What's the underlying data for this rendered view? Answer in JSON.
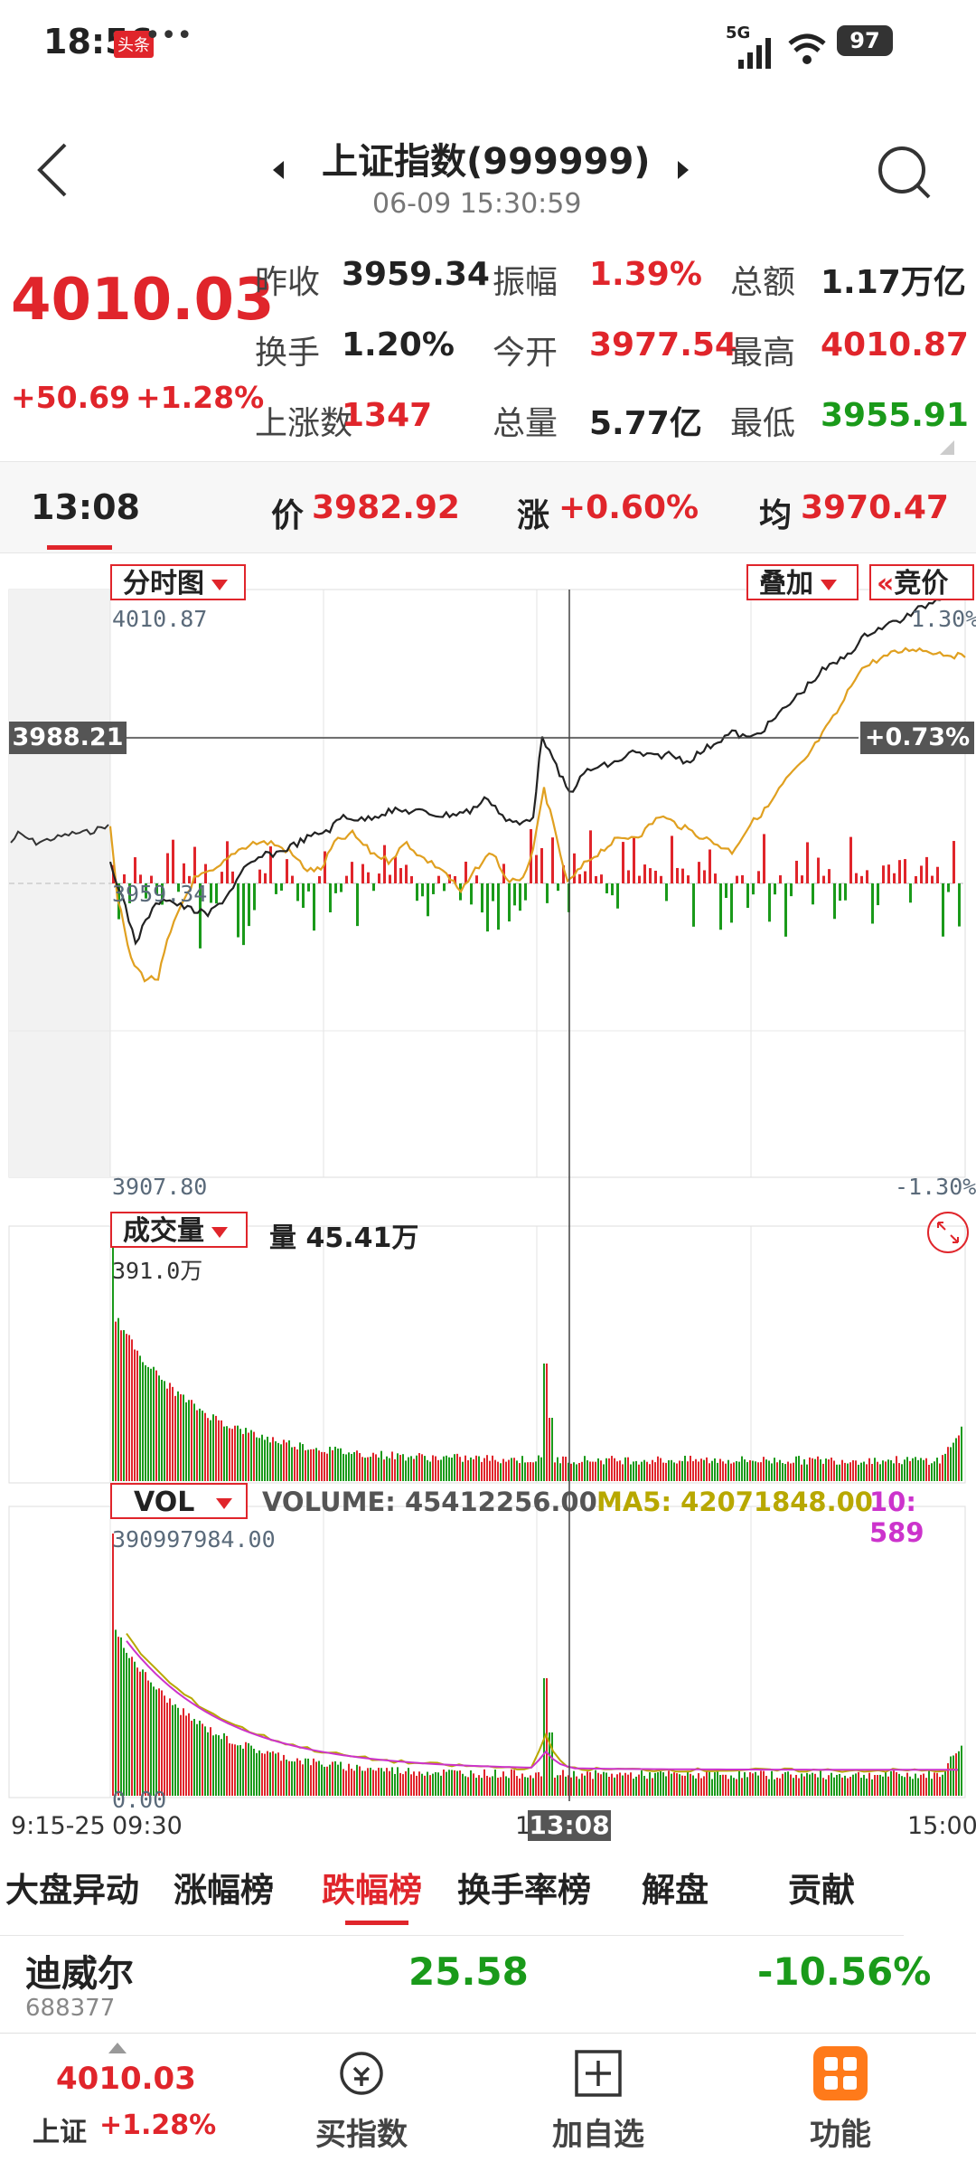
{
  "status": {
    "time": "18:56",
    "app_badge": "头条",
    "more": "•••",
    "network": "5G",
    "battery": "97"
  },
  "header": {
    "title": "上证指数(999999)",
    "datetime": "06-09 15:30:59"
  },
  "quote": {
    "price": "4010.03",
    "change": "+50.69",
    "change_pct": "+1.28%",
    "rows": [
      [
        {
          "label": "昨收",
          "value": "3959.34",
          "color": "dark"
        },
        {
          "label": "振幅",
          "value": "1.39%",
          "color": "red"
        },
        {
          "label": "总额",
          "value": "1.17万亿",
          "color": "dark"
        }
      ],
      [
        {
          "label": "换手",
          "value": "1.20%",
          "color": "dark"
        },
        {
          "label": "今开",
          "value": "3977.54",
          "color": "red"
        },
        {
          "label": "最高",
          "value": "4010.87",
          "color": "red"
        }
      ],
      [
        {
          "label": "上涨数",
          "value": "1347",
          "color": "red"
        },
        {
          "label": "总量",
          "value": "5.77亿",
          "color": "dark"
        },
        {
          "label": "最低",
          "value": "3955.91",
          "color": "green"
        }
      ]
    ]
  },
  "cursor_bar": {
    "time": "13:08",
    "price_label": "价",
    "price": "3982.92",
    "chg_label": "涨",
    "chg": "+0.60%",
    "avg_label": "均",
    "avg": "3970.47"
  },
  "chart": {
    "mode_label": "分时图",
    "overlay_label": "叠加",
    "auction_label": "竞价",
    "y_top": "4010.87",
    "y_mid": "3959.34",
    "y_bottom": "3907.80",
    "pct_top": "1.30%",
    "pct_bottom": "-1.30%",
    "cross_price": "3988.21",
    "cross_pct": "+0.73%",
    "vol_label": "成交量",
    "vol_text": "量 45.41万",
    "vol_max": "391.0万",
    "ind_label": "VOL",
    "ind_volume": "VOLUME: 45412256.00",
    "ind_ma5": "MA5: 42071848.00",
    "ind_ma10": "10: 589",
    "ind_max": "390997984.00",
    "ind_zero": "0.00",
    "t_start": "9:15-25",
    "t_open": "09:30",
    "t_cursor": "13:08",
    "t_partial": "1",
    "t_end": "15:00"
  },
  "tabs": [
    {
      "label": "大盘异动",
      "active": false
    },
    {
      "label": "涨幅榜",
      "active": false
    },
    {
      "label": "跌幅榜",
      "active": true
    },
    {
      "label": "换手率榜",
      "active": false
    },
    {
      "label": "解盘",
      "active": false
    },
    {
      "label": "贡献",
      "active": false
    }
  ],
  "stock_row": {
    "name": "迪威尔",
    "code": "688377",
    "price": "25.58",
    "pct": "-10.56%"
  },
  "bottom_nav": {
    "index_price": "4010.03",
    "index_name": "上证",
    "index_pct": "+1.28%",
    "buy": "买指数",
    "add": "加自选",
    "func": "功能"
  },
  "colors": {
    "up": "#e0252b",
    "down": "#1a9a1a",
    "avg_line": "#e0a020",
    "ma10": "#cc33cc"
  }
}
